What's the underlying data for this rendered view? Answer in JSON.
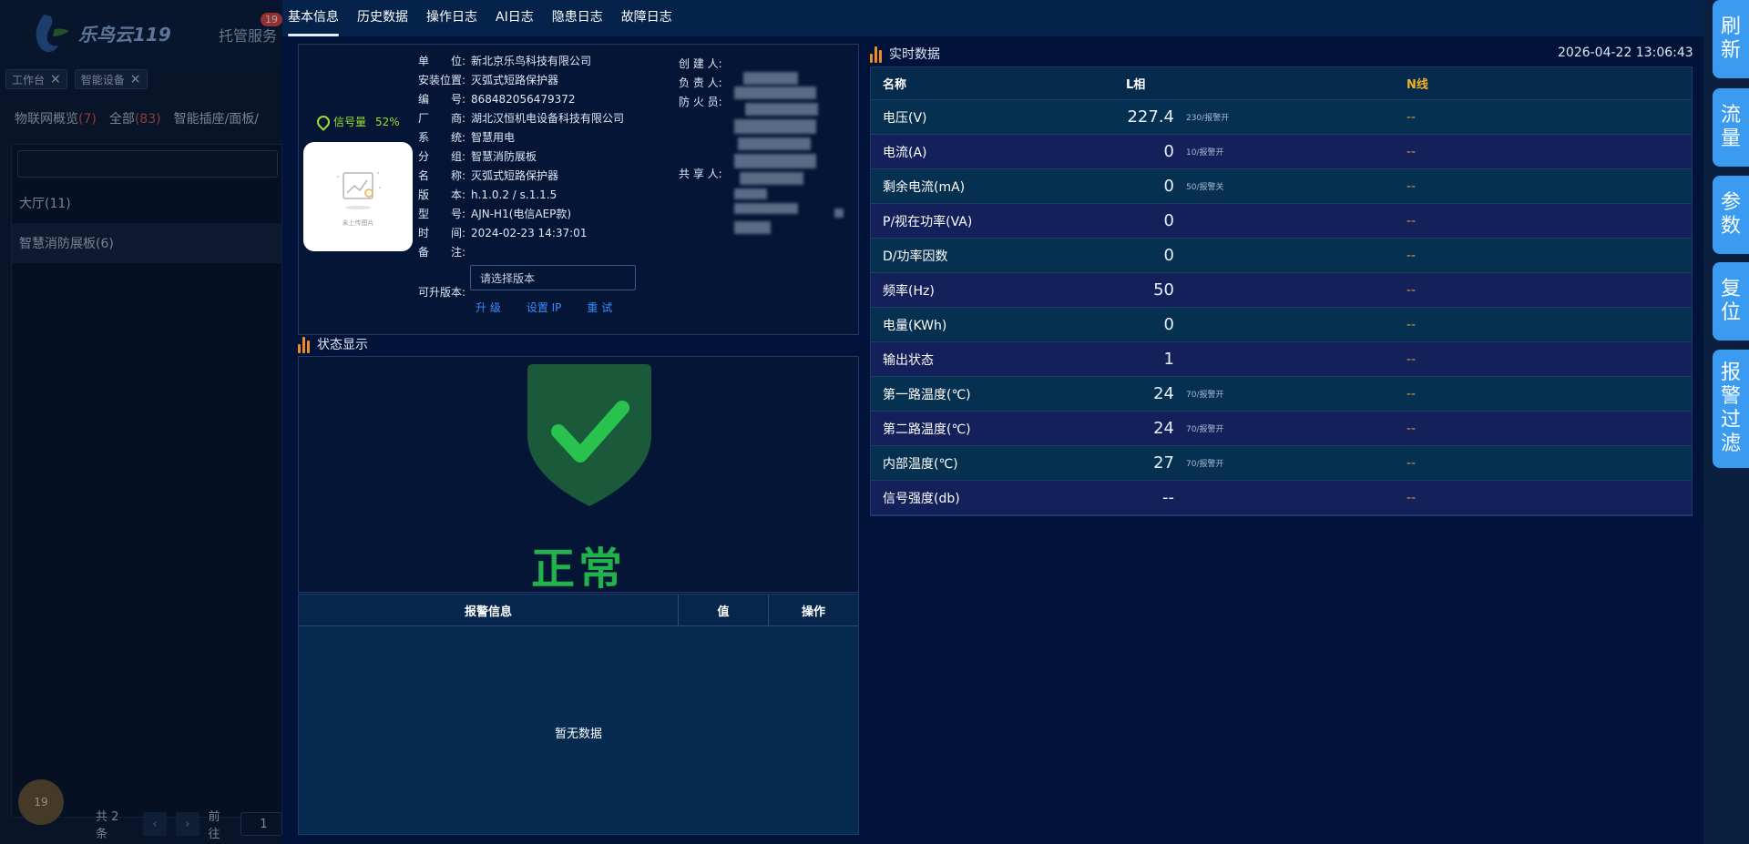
{
  "background": {
    "logo_text": "乐鸟云119",
    "menu_item": "托管服务",
    "menu_badge": "19",
    "tags": [
      "工作台",
      "智能设备"
    ],
    "filters": [
      {
        "label": "物联网概览",
        "count": "(7)"
      },
      {
        "label": "全部",
        "count": "(83)"
      },
      {
        "label": "智能插座/面板/",
        "count": ""
      }
    ],
    "list": [
      "大厅(11)",
      "智慧消防展板(6)"
    ],
    "pager": {
      "total": "共 2 条",
      "prev": "‹",
      "next": "›",
      "goto": "前往",
      "page": "1"
    },
    "avatar": "19"
  },
  "tabs": [
    "基本信息",
    "历史数据",
    "操作日志",
    "AI日志",
    "隐患日志",
    "故障日志"
  ],
  "signal": {
    "label": "信号量",
    "value": "52%"
  },
  "photo_caption": "未上传图片",
  "fields": [
    {
      "label": "单　　位:",
      "value": "新北京乐鸟科技有限公司"
    },
    {
      "label": "安装位置:",
      "value": "灭弧式短路保护器"
    },
    {
      "label": "编　　号:",
      "value": "868482056479372"
    },
    {
      "label": "厂　　商:",
      "value": "湖北汉恒机电设备科技有限公司"
    },
    {
      "label": "系　　统:",
      "value": "智慧用电"
    },
    {
      "label": "分　　组:",
      "value": "智慧消防展板"
    },
    {
      "label": "名　　称:",
      "value": "灭弧式短路保护器"
    },
    {
      "label": "版　　本:",
      "value": "h.1.0.2 / s.1.1.5"
    },
    {
      "label": "型　　号:",
      "value": "AJN-H1(电信AEP款)"
    },
    {
      "label": "时　　间:",
      "value": "2024-02-23 14:37:01"
    },
    {
      "label": "备　　注:",
      "value": ""
    }
  ],
  "people": [
    "创 建 人:",
    "负 责 人:",
    "防 火 员:"
  ],
  "share_label": "共 享 人:",
  "version": {
    "label": "可升版本:",
    "placeholder": "请选择版本"
  },
  "actions": [
    "升 级",
    "设置 IP",
    "重 试"
  ],
  "status": {
    "title": "状态显示",
    "text": "正常",
    "color": "#22b24c"
  },
  "alarm": {
    "headers": [
      "报警信息",
      "值",
      "操作"
    ],
    "empty": "暂无数据"
  },
  "realtime": {
    "title": "实时数据",
    "time": "2026-04-22 13:06:43",
    "headers": [
      "名称",
      "L相",
      "N线"
    ],
    "rows": [
      {
        "name": "电压(V)",
        "value": "227.4",
        "threshold": "230/报警开",
        "n": "--"
      },
      {
        "name": "电流(A)",
        "value": "0",
        "threshold": "10/报警开",
        "n": "--"
      },
      {
        "name": "剩余电流(mA)",
        "value": "0",
        "threshold": "50/报警关",
        "n": "--"
      },
      {
        "name": "P/视在功率(VA)",
        "value": "0",
        "threshold": "",
        "n": "--"
      },
      {
        "name": "D/功率因数",
        "value": "0",
        "threshold": "",
        "n": "--"
      },
      {
        "name": "频率(Hz)",
        "value": "50",
        "threshold": "",
        "n": "--"
      },
      {
        "name": "电量(KWh)",
        "value": "0",
        "threshold": "",
        "n": "--"
      },
      {
        "name": "输出状态",
        "value": "1",
        "threshold": "",
        "n": "--"
      },
      {
        "name": "第一路温度(℃)",
        "value": "24",
        "threshold": "70/报警开",
        "n": "--"
      },
      {
        "name": "第二路温度(℃)",
        "value": "24",
        "threshold": "70/报警开",
        "n": "--"
      },
      {
        "name": "内部温度(℃)",
        "value": "27",
        "threshold": "70/报警开",
        "n": "--"
      },
      {
        "name": "信号强度(db)",
        "value": "--",
        "threshold": "",
        "n": "--"
      }
    ]
  },
  "side_buttons": [
    "刷新",
    "流量",
    "参数",
    "复位",
    "报警过滤"
  ],
  "colors": {
    "accent": "#3a9bf0",
    "ok": "#22b24c",
    "warn": "#f08a24",
    "n_header": "#f0b128"
  }
}
